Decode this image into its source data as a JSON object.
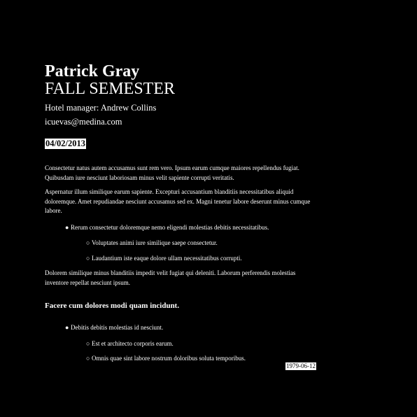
{
  "header": {
    "name": "Patrick Gray",
    "semester": "FALL SEMESTER",
    "manager": "Hotel manager: Andrew Collins",
    "email": "icuevas@medina.com",
    "date": "04/02/2013"
  },
  "body": {
    "paragraph1": "Consectetur natus autem accusamus sunt rem vero. Ipsum earum cumque maiores repellendus fugiat. Quibusdam iure nesciunt laboriosam minus velit sapiente corrupti veritatis.",
    "paragraph2": "Aspernatur illum similique earum sapiente. Excepturi accusantium blanditiis necessitatibus aliquid doloremque. Amet repudiandae nesciunt accusamus sed ex. Magni tenetur labore deserunt minus cumque labore.",
    "list1": {
      "item": "Rerum consectetur doloremque nemo eligendi molestias debitis necessitatibus.",
      "subitems": [
        "Voluptates animi iure similique saepe consectetur.",
        "Laudantium iste eaque dolore ullam necessitatibus corrupti."
      ]
    },
    "paragraph3": "Dolorem similique minus blanditiis impedit velit fugiat qui deleniti. Laborum perferendis molestias inventore repellat nesciunt ipsum.",
    "heading": "Facere cum dolores modi quam incidunt.",
    "list2": {
      "item": "Debitis debitis molestias id nesciunt.",
      "subitems": [
        "Est et architecto corporis earum.",
        "Omnis quae sint labore nostrum doloribus soluta temporibus."
      ]
    },
    "footer_date": "1979-06-12"
  },
  "markers": {
    "bullet": "●",
    "circle": "○"
  },
  "colors": {
    "background": "#000000",
    "text": "#ffffff",
    "highlight_bg": "#ffffff",
    "highlight_text": "#000000"
  }
}
